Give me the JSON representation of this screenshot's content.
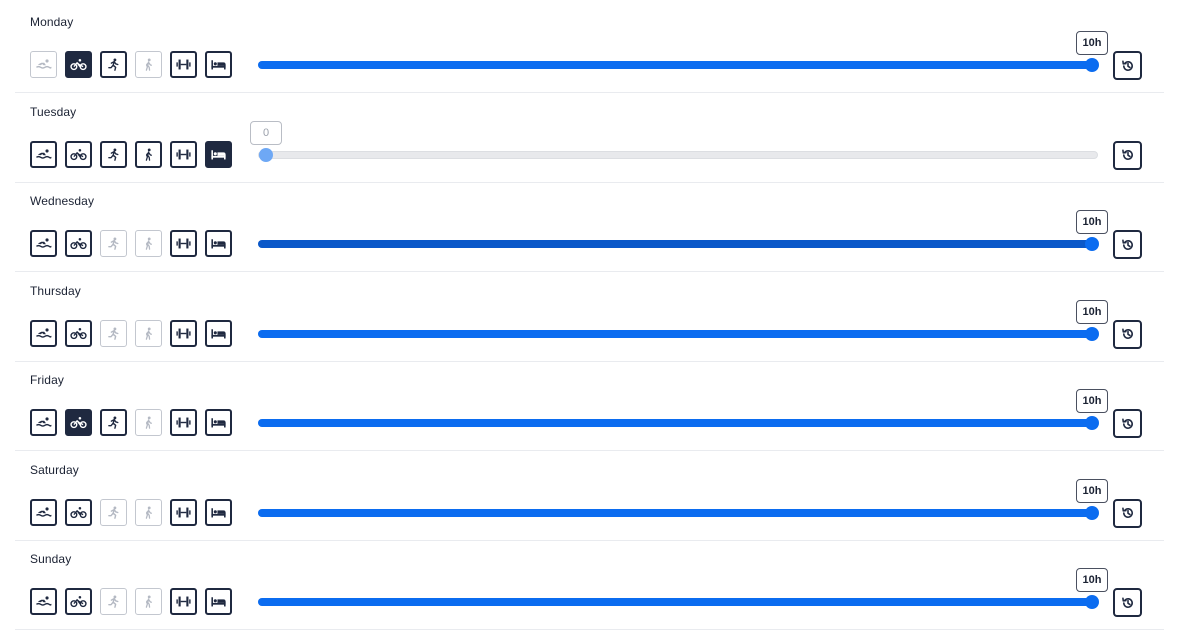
{
  "activity_icons": [
    "swim-icon",
    "bike-icon",
    "run-icon",
    "walk-icon",
    "strength-icon",
    "rest-icon"
  ],
  "colors": {
    "accent": "#0b6cf0",
    "dark": "#1f2940",
    "disabled": "#b4b9c3",
    "track": "#e8e9ec"
  },
  "slider": {
    "min": 0,
    "max": 10,
    "unit": "h"
  },
  "days": [
    {
      "name": "Monday",
      "activities": [
        "disabled",
        "selected",
        "normal",
        "disabled",
        "normal",
        "normal"
      ],
      "hours": 10,
      "hours_label": "10h"
    },
    {
      "name": "Tuesday",
      "activities": [
        "normal",
        "normal",
        "normal",
        "normal",
        "normal",
        "selected"
      ],
      "hours": 0,
      "hours_label": "0"
    },
    {
      "name": "Wednesday",
      "activities": [
        "normal",
        "normal",
        "disabled",
        "disabled",
        "normal",
        "normal"
      ],
      "hours": 10,
      "hours_label": "10h"
    },
    {
      "name": "Thursday",
      "activities": [
        "normal",
        "normal",
        "disabled",
        "disabled",
        "normal",
        "normal"
      ],
      "hours": 10,
      "hours_label": "10h"
    },
    {
      "name": "Friday",
      "activities": [
        "normal",
        "selected",
        "normal",
        "disabled",
        "normal",
        "normal"
      ],
      "hours": 10,
      "hours_label": "10h"
    },
    {
      "name": "Saturday",
      "activities": [
        "normal",
        "normal",
        "disabled",
        "disabled",
        "normal",
        "normal"
      ],
      "hours": 10,
      "hours_label": "10h"
    },
    {
      "name": "Sunday",
      "activities": [
        "normal",
        "normal",
        "disabled",
        "disabled",
        "normal",
        "normal"
      ],
      "hours": 10,
      "hours_label": "10h"
    }
  ]
}
